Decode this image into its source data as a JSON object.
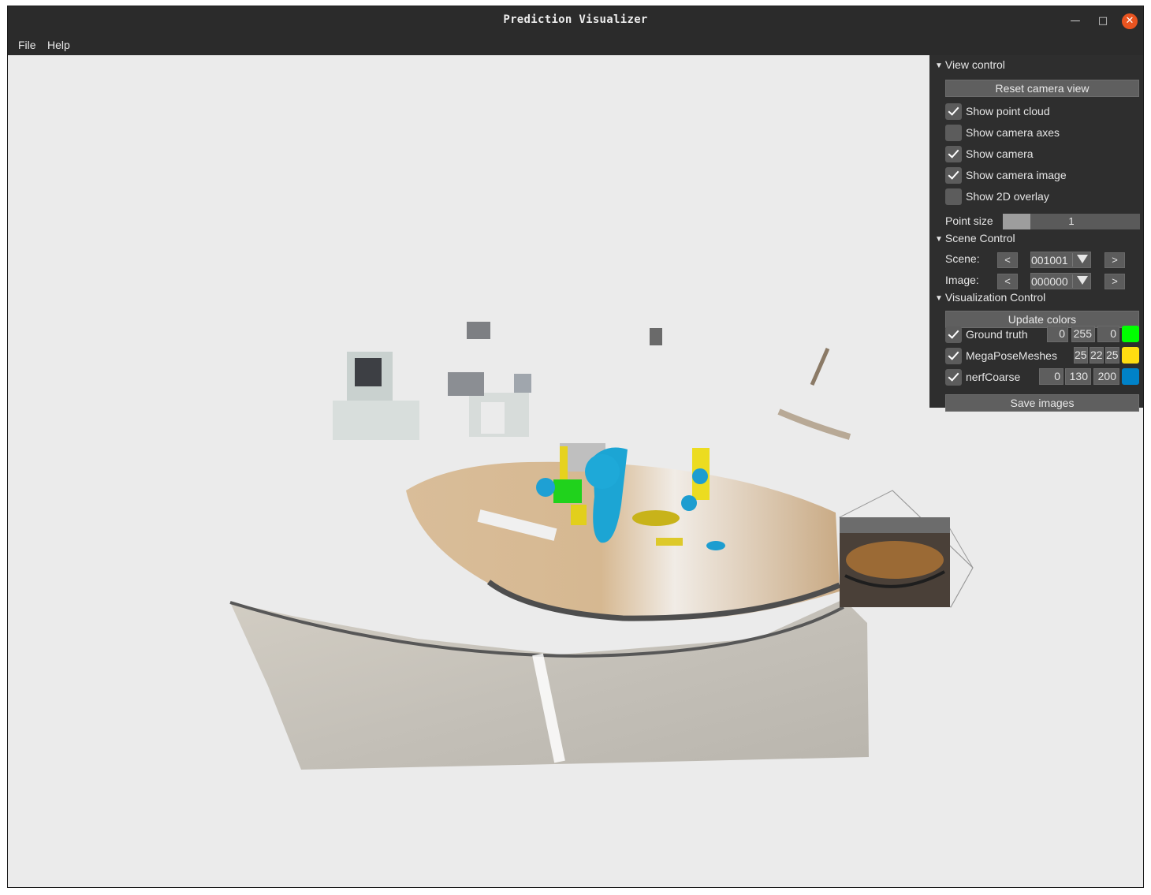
{
  "window": {
    "title": "Prediction Visualizer"
  },
  "menu": {
    "file": "File",
    "help": "Help"
  },
  "view_control": {
    "header": "View control",
    "reset_label": "Reset camera view",
    "options": [
      {
        "label": "Show point cloud",
        "checked": true
      },
      {
        "label": "Show camera axes",
        "checked": false
      },
      {
        "label": "Show camera",
        "checked": true
      },
      {
        "label": "Show camera image",
        "checked": true
      },
      {
        "label": "Show 2D overlay",
        "checked": false
      }
    ],
    "point_size_label": "Point size",
    "point_size_value": "1"
  },
  "scene_control": {
    "header": "Scene Control",
    "scene_label": "Scene:",
    "scene_value": "001001",
    "image_label": "Image:",
    "image_value": "000000",
    "prev": "<",
    "next": ">"
  },
  "vis_control": {
    "header": "Visualization Control",
    "update_label": "Update colors",
    "methods": [
      {
        "label": "Ground truth",
        "checked": true,
        "r": "0",
        "g": "255",
        "b": "0",
        "color": "#00ff00"
      },
      {
        "label": "MegaPoseMeshes",
        "checked": true,
        "r": "25",
        "g": "22",
        "b": "25",
        "color": "#ffdd11"
      },
      {
        "label": "nerfCoarse",
        "checked": true,
        "r": "0",
        "g": "130",
        "b": "200",
        "color": "#0082c8"
      }
    ],
    "save_label": "Save images"
  },
  "icons": {
    "minimize": "minimize-icon",
    "maximize": "maximize-icon",
    "close": "close-icon",
    "collapse": "triangle-down-icon",
    "dropdown": "dropdown-arrow-icon",
    "check": "checkmark-icon"
  }
}
